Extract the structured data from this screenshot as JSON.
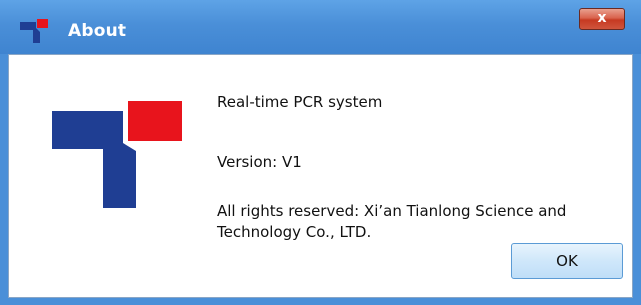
{
  "window": {
    "title": "About",
    "close_label": "x"
  },
  "content": {
    "product_name": "Real-time PCR system",
    "version": "Version: V1",
    "copyright_line1": "All rights reserved: Xi’an Tianlong Science and",
    "copyright_line2": "Technology Co., LTD."
  },
  "buttons": {
    "ok_label": "OK"
  },
  "colors": {
    "titlebar": "#4a8fd8",
    "logo_blue": "#1f3e93",
    "logo_red": "#e8141c",
    "close_button": "#c63a22"
  },
  "icons": {
    "app_icon": "tianlong-logo-icon",
    "close": "close-icon"
  }
}
